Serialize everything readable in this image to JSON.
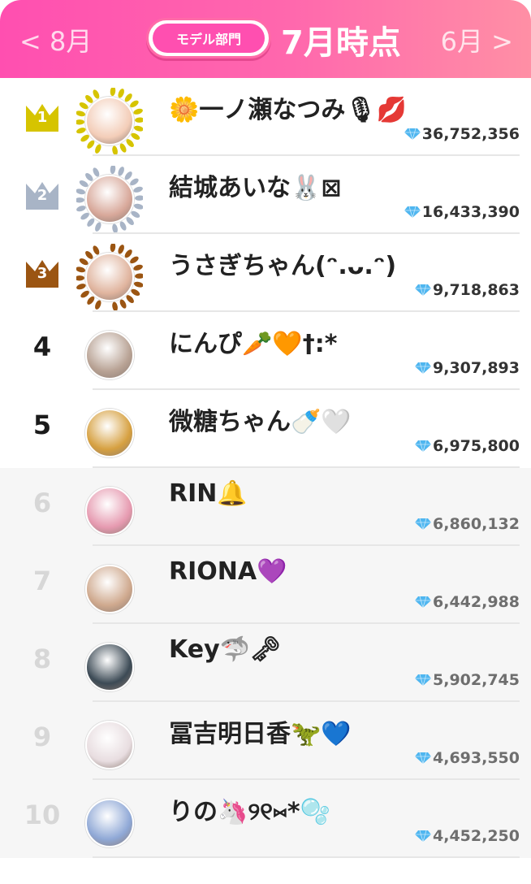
{
  "header": {
    "prev_label": "< 8月",
    "next_label": "6月 >",
    "department_label": "モデル部門",
    "month_title": "7月時点"
  },
  "colors": {
    "header_gradient_start": "#ff4fb0",
    "header_gradient_end": "#ff8fa5",
    "gold": "#d6c400",
    "silver": "#a8b4c6",
    "bronze": "#9b5512",
    "diamond": "#4fb6f0"
  },
  "ranking": [
    {
      "rank": "1",
      "name": "🌼一ノ瀬なつみ🎙💋",
      "score": "36,752,356",
      "badge": "gold-crown",
      "avatar_color": "#f3cdb8"
    },
    {
      "rank": "2",
      "name": "結城あいな🐰⊠",
      "score": "16,433,390",
      "badge": "silver-crown",
      "avatar_color": "#d8a89a"
    },
    {
      "rank": "3",
      "name": "うさぎちゃん(ᵔ.ᴗ.ᵔ)",
      "score": "9,718,863",
      "badge": "bronze-crown",
      "avatar_color": "#e0b49e"
    },
    {
      "rank": "4",
      "name": "にんぴ🥕🧡†:*",
      "score": "9,307,893",
      "badge": "none",
      "avatar_color": "#b8a294"
    },
    {
      "rank": "5",
      "name": "微糖ちゃん🍼🤍",
      "score": "6,975,800",
      "badge": "none",
      "avatar_color": "#d6a040"
    },
    {
      "rank": "6",
      "name": "RIN🔔",
      "score": "6,860,132",
      "badge": "none",
      "avatar_color": "#e69ab0"
    },
    {
      "rank": "7",
      "name": "RIONA💜",
      "score": "6,442,988",
      "badge": "none",
      "avatar_color": "#cfa98e"
    },
    {
      "rank": "8",
      "name": "Key🦈🗝",
      "score": "5,902,745",
      "badge": "none",
      "avatar_color": "#3c4a55"
    },
    {
      "rank": "9",
      "name": "冨吉明日香🦖💙",
      "score": "4,693,550",
      "badge": "none",
      "avatar_color": "#e8dde0"
    },
    {
      "rank": "10",
      "name": "りの🦄୨୧⑅*🫧",
      "score": "4,452,250",
      "badge": "none",
      "avatar_color": "#8fa8d6"
    }
  ]
}
